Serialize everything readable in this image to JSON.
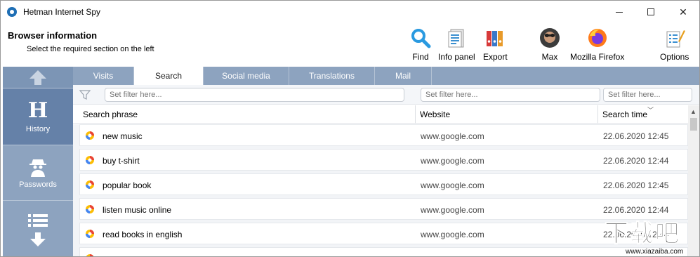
{
  "window": {
    "title": "Hetman Internet Spy",
    "controls": {
      "minimize": "minimize",
      "maximize": "maximize",
      "close": "✕"
    }
  },
  "header": {
    "title": "Browser information",
    "subtitle": "Select the required section on the left"
  },
  "toolbar": {
    "find": "Find",
    "info_panel": "Info panel",
    "export": "Export",
    "user": "Max",
    "browser": "Mozilla Firefox",
    "options": "Options"
  },
  "sidebar": {
    "history_label": "History",
    "history_letter": "H",
    "passwords_label": "Passwords"
  },
  "tabs": [
    {
      "label": "Visits",
      "active": false
    },
    {
      "label": "Search",
      "active": true
    },
    {
      "label": "Social media",
      "active": false
    },
    {
      "label": "Translations",
      "active": false
    },
    {
      "label": "Mail",
      "active": false
    }
  ],
  "filters": {
    "placeholder_1": "Set filter here...",
    "placeholder_2": "Set filter here...",
    "placeholder_3": "Set filter here..."
  },
  "columns": {
    "search_phrase": "Search phrase",
    "website": "Website",
    "search_time": "Search time"
  },
  "rows": [
    {
      "phrase": "new music",
      "website": "www.google.com",
      "time": "22.06.2020 12:45"
    },
    {
      "phrase": "buy t-shirt",
      "website": "www.google.com",
      "time": "22.06.2020 12:44"
    },
    {
      "phrase": "popular book",
      "website": "www.google.com",
      "time": "22.06.2020 12:45"
    },
    {
      "phrase": "listen music online",
      "website": "www.google.com",
      "time": "22.06.2020 12:44"
    },
    {
      "phrase": "read books in english",
      "website": "www.google.com",
      "time": "22.06.2020 12:44"
    }
  ],
  "watermark": {
    "main": "下载吧",
    "url": "www.xiazaiba.com"
  },
  "colors": {
    "sidebar": "#8da3bf",
    "sidebar_active": "#6581a8",
    "accent_blue": "#1f6fb5"
  }
}
